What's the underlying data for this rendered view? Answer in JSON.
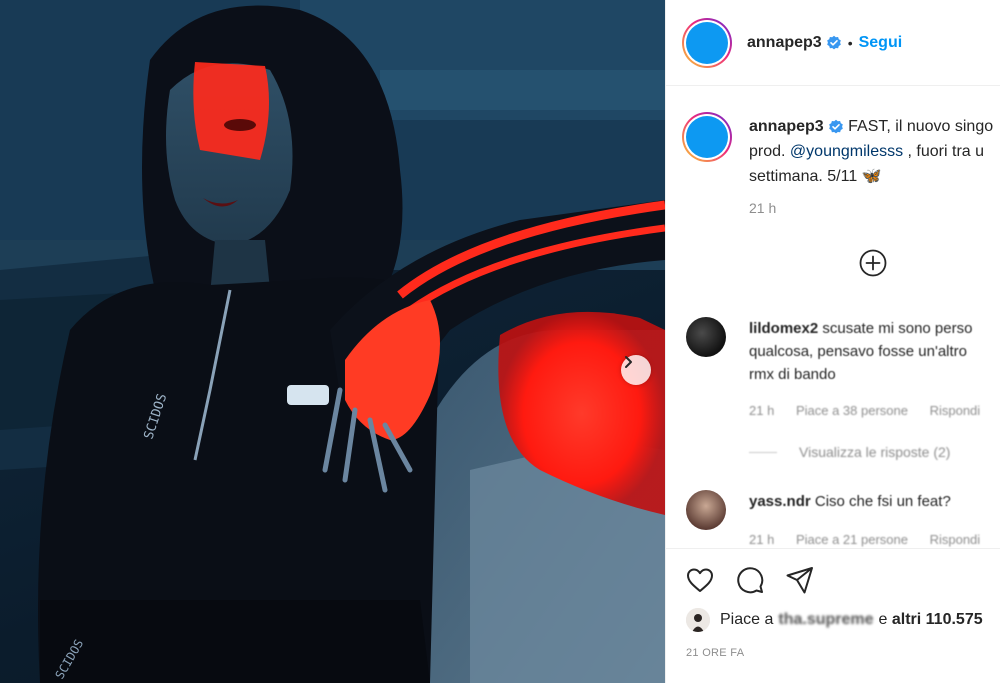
{
  "post": {
    "username": "annapep3",
    "follow_label": "Segui",
    "separator": "•",
    "caption_parts": [
      "FAST, il nuovo singo",
      "prod. ",
      "@youngmilesss",
      " , fuori tra u",
      "settimana. 5/11 "
    ],
    "caption_emoji": "🦋",
    "caption_time": "21 h"
  },
  "comments": [
    {
      "username": "lildomex2",
      "lines": [
        "scusate mi sono perso",
        "qualcosa, pensavo fosse un'altro",
        "rmx di bando"
      ],
      "time": "21 h",
      "likes": "Piace a 38 persone",
      "reply": "Rispondi",
      "view_replies": "Visualizza le risposte (2)"
    },
    {
      "username": "yass.ndr",
      "lines": [
        "Ciso che fsi un feat?"
      ],
      "time": "21 h",
      "likes": "Piace a 21 persone",
      "reply": "Rispondi"
    }
  ],
  "likes": {
    "prefix": "Piace a",
    "liker": "tha.supreme",
    "conj": "e",
    "others": "altri 110.575"
  },
  "date": "21 ORE FA",
  "icons": [
    "verified-badge-icon",
    "chevron-right-icon",
    "add-circle-icon",
    "heart-icon",
    "comment-icon",
    "share-icon"
  ],
  "colors": {
    "accent": "#0095f6",
    "avatar": "#0d99f2",
    "mention": "#00376b",
    "muted": "#8e8e8e"
  }
}
